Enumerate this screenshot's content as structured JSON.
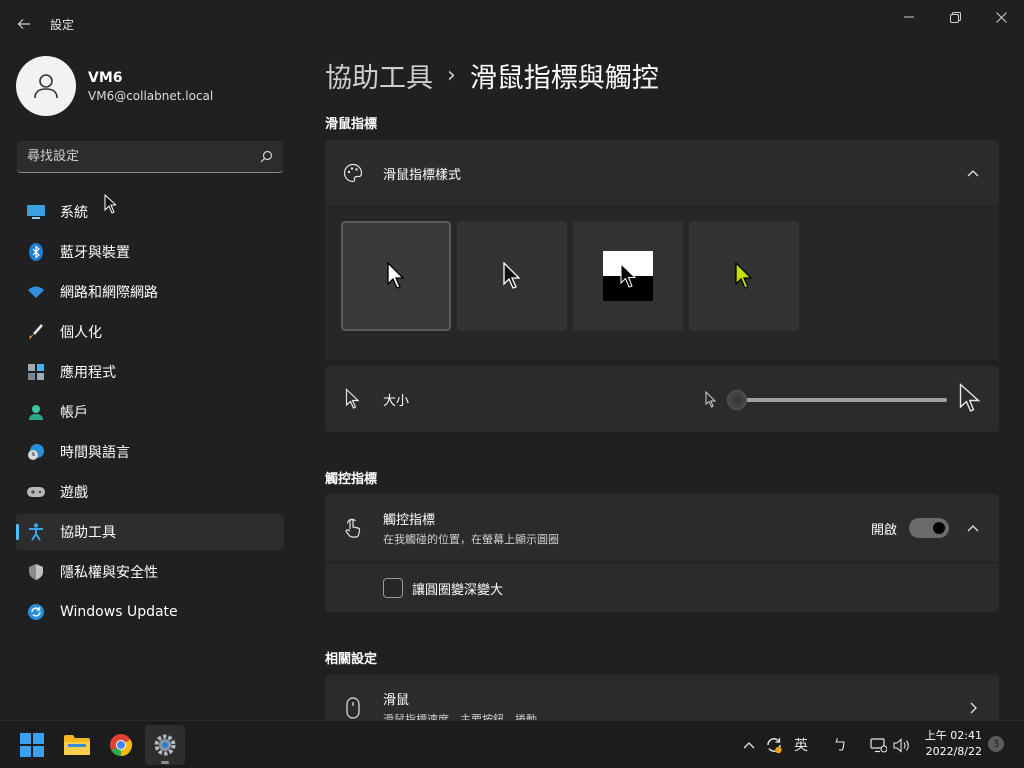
{
  "window": {
    "title": "設定",
    "controls": {
      "minimize": "minimize",
      "maximize": "maximize",
      "close": "close"
    }
  },
  "profile": {
    "name": "VM6",
    "email": "VM6@collabnet.local"
  },
  "search": {
    "placeholder": "尋找設定"
  },
  "sidebar": {
    "items": [
      {
        "label": "系統",
        "icon": "monitor-icon"
      },
      {
        "label": "藍牙與裝置",
        "icon": "bluetooth-icon"
      },
      {
        "label": "網路和網際網路",
        "icon": "wifi-icon"
      },
      {
        "label": "個人化",
        "icon": "brush-icon"
      },
      {
        "label": "應用程式",
        "icon": "apps-icon"
      },
      {
        "label": "帳戶",
        "icon": "person-icon"
      },
      {
        "label": "時間與語言",
        "icon": "clock-globe-icon"
      },
      {
        "label": "遊戲",
        "icon": "gamepad-icon"
      },
      {
        "label": "協助工具",
        "icon": "accessibility-icon",
        "active": true
      },
      {
        "label": "隱私權與安全性",
        "icon": "shield-icon"
      },
      {
        "label": "Windows Update",
        "icon": "update-icon"
      }
    ]
  },
  "breadcrumb": {
    "parent": "協助工具",
    "separator": "›",
    "current": "滑鼠指標與觸控"
  },
  "sections": {
    "mouse_pointer": {
      "heading": "滑鼠指標",
      "style_label": "滑鼠指標樣式",
      "styles": [
        "white",
        "black",
        "inverted",
        "custom-lime"
      ],
      "selected_style": "white",
      "size_label": "大小",
      "size_value": 0.0
    },
    "touch": {
      "heading": "觸控指標",
      "indicator_label": "觸控指標",
      "indicator_sub": "在我觸碰的位置，在螢幕上顯示圓圈",
      "state_label": "開啟",
      "enabled": true,
      "darker_label": "讓圓圈變深變大",
      "darker_checked": false
    },
    "related": {
      "heading": "相關設定",
      "mouse_label": "滑鼠",
      "mouse_sub": "滑鼠指標速度，主要按鈕，捲動"
    }
  },
  "taskbar": {
    "apps": [
      "start-icon",
      "file-explorer-icon",
      "chrome-icon",
      "settings-icon"
    ],
    "ime": "英",
    "ime_mode": "ㄅ",
    "time": "上午 02:41",
    "date": "2022/8/22",
    "notifications": "3"
  },
  "colors": {
    "accent": "#4cc2ff",
    "lime_cursor": "#c8e000"
  }
}
